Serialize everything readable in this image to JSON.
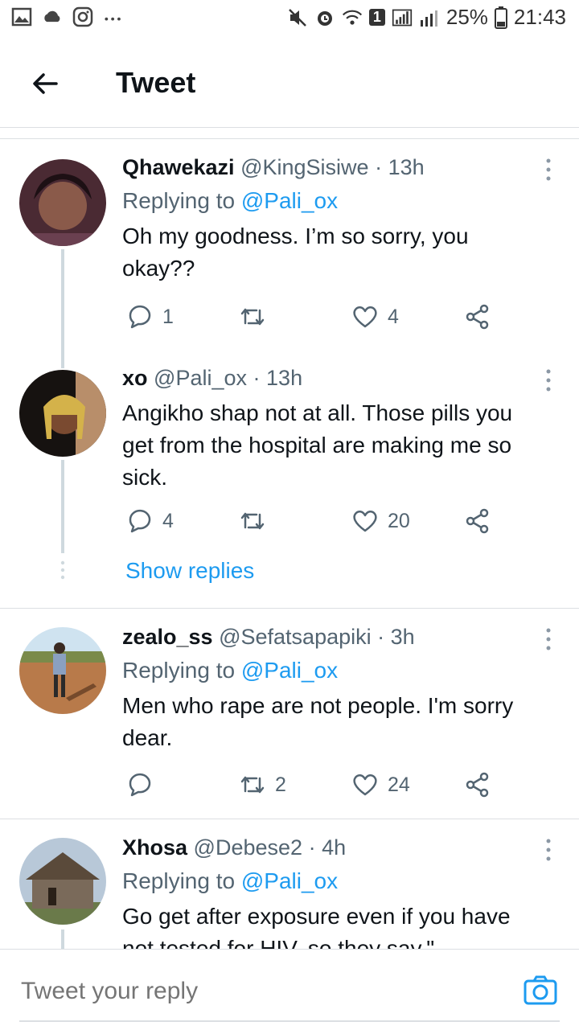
{
  "status_bar": {
    "battery": "25%",
    "time": "21:43",
    "sim_badge": "1"
  },
  "header": {
    "title": "Tweet"
  },
  "tweets": [
    {
      "name": "Qhawekazi",
      "handle": "@KingSisiwe",
      "sep": "·",
      "time": "13h",
      "replying_label": "Replying to",
      "replying_handle": "@Pali_ox",
      "text": "Oh my goodness. I’m so sorry, you okay??",
      "replies": "1",
      "retweets": "",
      "likes": "4"
    },
    {
      "name": "xo",
      "handle": "@Pali_ox",
      "sep": "·",
      "time": "13h",
      "text": "Angikho shap not at all. Those pills you get from the hospital are making me so sick.",
      "replies": "4",
      "retweets": "",
      "likes": "20",
      "show_replies": "Show replies"
    },
    {
      "name": "zealo_ss",
      "handle": "@Sefatsapapiki",
      "sep": "·",
      "time": "3h",
      "replying_label": "Replying to",
      "replying_handle": "@Pali_ox",
      "text": "Men who rape are not people. I'm sorry dear.",
      "replies": "",
      "retweets": "2",
      "likes": "24"
    },
    {
      "name": "Xhosa",
      "handle": "@Debese2",
      "sep": "·",
      "time": "4h",
      "replying_label": "Replying to",
      "replying_handle": "@Pali_ox",
      "text": "Go get after exposure even if you have not tested for HIV, so they say.\""
    }
  ],
  "reply_bar": {
    "placeholder": "Tweet your reply"
  },
  "colors": {
    "accent": "#1d9bf0",
    "muted": "#536471",
    "text": "#0f1419",
    "divider": "#dcdfe3"
  }
}
